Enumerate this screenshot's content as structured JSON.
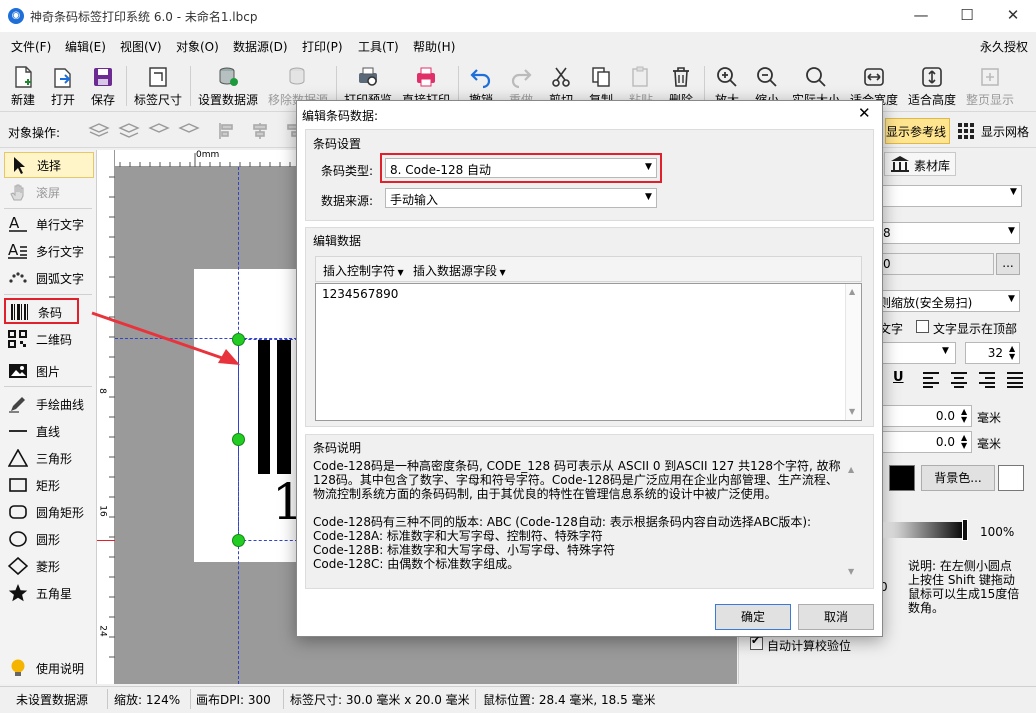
{
  "window": {
    "title": "神奇条码标签打印系统 6.0 - 未命名1.lbcp",
    "app_icon": "app-logo-icon"
  },
  "menu": {
    "items": [
      "文件(F)",
      "编辑(E)",
      "视图(V)",
      "对象(O)",
      "数据源(D)",
      "打印(P)",
      "工具(T)",
      "帮助(H)"
    ],
    "license": "永久授权"
  },
  "toolbar": {
    "buttons": [
      {
        "label": "新建",
        "icon": "new-file-icon",
        "enabled": true
      },
      {
        "label": "打开",
        "icon": "open-icon",
        "enabled": true
      },
      {
        "label": "保存",
        "icon": "save-icon",
        "enabled": true
      },
      {
        "label": "标签尺寸",
        "icon": "label-size-icon",
        "enabled": true
      },
      {
        "label": "设置数据源",
        "icon": "database-icon",
        "enabled": true
      },
      {
        "label": "移除数据源",
        "icon": "remove-database-icon",
        "enabled": false
      },
      {
        "label": "打印预览",
        "icon": "print-preview-icon",
        "enabled": true
      },
      {
        "label": "直接打印",
        "icon": "printer-icon",
        "enabled": true
      },
      {
        "label": "撤销",
        "icon": "undo-icon",
        "enabled": true
      },
      {
        "label": "重做",
        "icon": "redo-icon",
        "enabled": false
      },
      {
        "label": "剪切",
        "icon": "cut-icon",
        "enabled": true
      },
      {
        "label": "复制",
        "icon": "copy-icon",
        "enabled": true
      },
      {
        "label": "粘贴",
        "icon": "paste-icon",
        "enabled": false
      },
      {
        "label": "删除",
        "icon": "delete-icon",
        "enabled": true
      },
      {
        "label": "放大",
        "icon": "zoom-in-icon",
        "enabled": true
      },
      {
        "label": "缩小",
        "icon": "zoom-out-icon",
        "enabled": true
      },
      {
        "label": "实际大小",
        "icon": "actual-size-icon",
        "enabled": true
      },
      {
        "label": "适合宽度",
        "icon": "fit-width-icon",
        "enabled": true
      },
      {
        "label": "适合高度",
        "icon": "fit-height-icon",
        "enabled": true
      },
      {
        "label": "整页显示",
        "icon": "full-page-icon",
        "enabled": false
      }
    ]
  },
  "object_bar": {
    "label": "对象操作:",
    "show_guides": "显示参考线",
    "show_grid": "显示网格"
  },
  "tools": [
    {
      "label": "选择",
      "icon": "cursor-icon"
    },
    {
      "label": "滚屏",
      "icon": "hand-icon"
    },
    {
      "label": "单行文字",
      "icon": "single-line-text-icon"
    },
    {
      "label": "多行文字",
      "icon": "multi-line-text-icon"
    },
    {
      "label": "圆弧文字",
      "icon": "arc-text-icon"
    },
    {
      "label": "条码",
      "icon": "barcode-icon"
    },
    {
      "label": "二维码",
      "icon": "qrcode-icon"
    },
    {
      "label": "图片",
      "icon": "image-icon"
    },
    {
      "label": "手绘曲线",
      "icon": "pen-icon"
    },
    {
      "label": "直线",
      "icon": "line-icon"
    },
    {
      "label": "三角形",
      "icon": "triangle-icon"
    },
    {
      "label": "矩形",
      "icon": "rectangle-icon"
    },
    {
      "label": "圆角矩形",
      "icon": "rounded-rectangle-icon"
    },
    {
      "label": "圆形",
      "icon": "circle-icon"
    },
    {
      "label": "菱形",
      "icon": "diamond-icon"
    },
    {
      "label": "五角星",
      "icon": "star-icon"
    }
  ],
  "help_tool": {
    "label": "使用说明",
    "icon": "lightbulb-icon"
  },
  "ruler": {
    "h_label": "0mm",
    "v_labels": [
      "8",
      "16",
      "24"
    ]
  },
  "canvas": {
    "barcode_digit": "1"
  },
  "right_panel": {
    "tab": "素材库",
    "row2_value": "8",
    "row3_value": "0",
    "browse": "...",
    "scale_mode": "则缩放(安全易扫)",
    "text_fragment": "文字",
    "text_on_top": "文字显示在顶部",
    "font_size": "32",
    "offset1": "0.0",
    "offset2": "0.0",
    "unit": "毫米",
    "bg_color_button": "背景色...",
    "opacity": "100%",
    "hint": "说明: 在左侧小圆点上按住 Shift 键拖动鼠标可以生成15度倍数角。",
    "hint_fragment": "0",
    "auto_check": "自动计算校验位"
  },
  "dialog": {
    "title": "编辑条码数据:",
    "barcode_settings": "条码设置",
    "type_label": "条码类型:",
    "type_value": "8. Code-128 自动",
    "source_label": "数据来源:",
    "source_value": "手动输入",
    "edit_data": "编辑数据",
    "insert_control": "插入控制字符",
    "insert_field": "插入数据源字段",
    "data_value": "1234567890",
    "desc_title": "条码说明",
    "desc_lines": [
      "Code-128码是一种高密度条码, CODE_128 码可表示从 ASCII 0 到ASCII 127 共128个字符, 故称",
      "128码。其中包含了数字、字母和符号字符。Code-128码是广泛应用在企业内部管理、生产流程、",
      "物流控制系统方面的条码码制, 由于其优良的特性在管理信息系统的设计中被广泛使用。",
      "",
      "Code-128码有三种不同的版本: ABC (Code-128自动: 表示根据条码内容自动选择ABC版本):",
      "Code-128A: 标准数字和大写字母、控制符、特殊字符",
      "Code-128B: 标准数字和大写字母、小写字母、特殊字符",
      "Code-128C: 由偶数个标准数字组成。"
    ],
    "ok": "确定",
    "cancel": "取消"
  },
  "status": {
    "datasource": "未设置数据源",
    "zoom": "缩放: 124%",
    "dpi": "画布DPI: 300",
    "label_size": "标签尺寸: 30.0 毫米 x 20.0 毫米",
    "mouse_pos": "鼠标位置: 28.4 毫米, 18.5 毫米"
  },
  "colors": {
    "accent": "#1e6fd9",
    "highlight": "#e0202a",
    "handle": "#22cc22",
    "guide": "#3344cc"
  }
}
